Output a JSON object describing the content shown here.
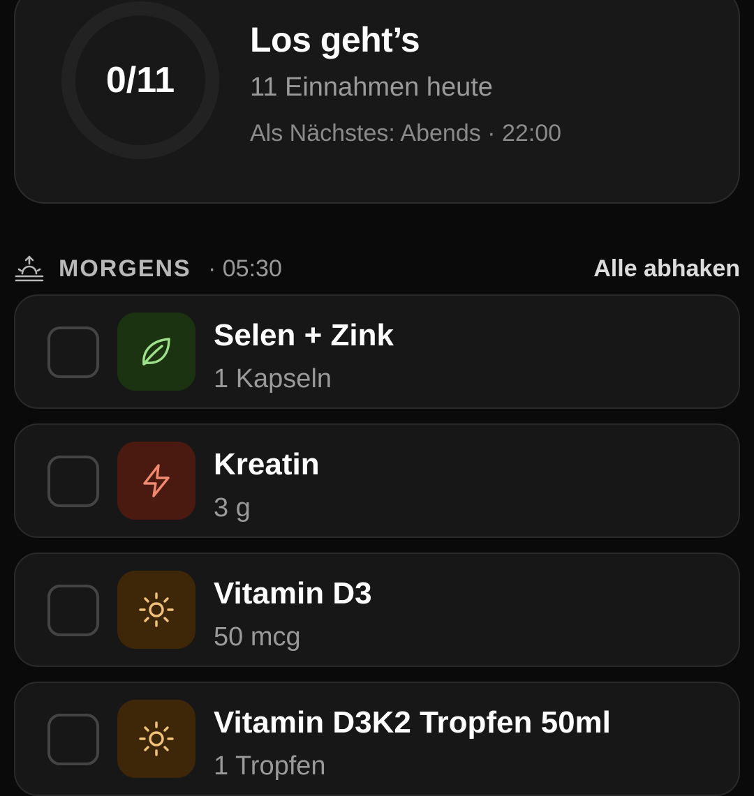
{
  "summary": {
    "progress_text": "0/11",
    "title": "Los geht’s",
    "subtitle": "11 Einnahmen heute",
    "next": "Als Nächstes: Abends · 22:00"
  },
  "section": {
    "icon": "sunrise-icon",
    "name": "MORGENS",
    "time": "· 05:30",
    "action": "Alle abhaken"
  },
  "items": [
    {
      "name": "Selen + Zink",
      "dose": "1 Kapseln",
      "icon": "leaf-icon",
      "tile_color": "#1c3312",
      "icon_color": "#9fe08a"
    },
    {
      "name": "Kreatin",
      "dose": "3 g",
      "icon": "lightning-icon",
      "tile_color": "#4a1a10",
      "icon_color": "#f08a6e"
    },
    {
      "name": "Vitamin D3",
      "dose": "50 mcg",
      "icon": "sun-icon",
      "tile_color": "#3e2608",
      "icon_color": "#f3c27a"
    },
    {
      "name": "Vitamin D3K2 Tropfen 50ml",
      "dose": "1 Tropfen",
      "icon": "sun-icon",
      "tile_color": "#3e2608",
      "icon_color": "#f3c27a"
    }
  ]
}
